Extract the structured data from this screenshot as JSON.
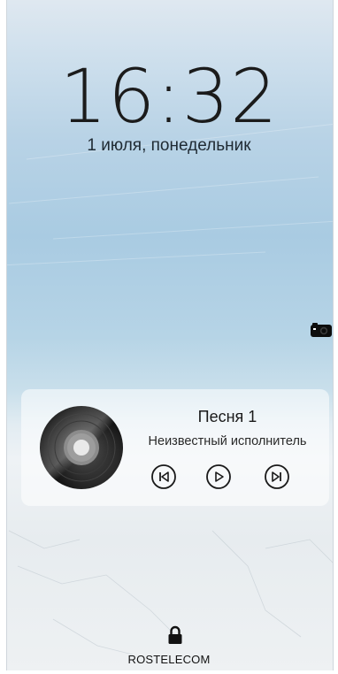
{
  "lockscreen": {
    "time": "16:32",
    "date": "1 июля, понедельник"
  },
  "music_player": {
    "title": "Песня 1",
    "artist": "Неизвестный исполнитель",
    "controls": [
      "previous",
      "play",
      "next"
    ]
  },
  "carrier": "ROSTELECOM",
  "icons": {
    "camera": "camera-icon",
    "lock": "lock-icon",
    "album": "vinyl-disc-icon"
  },
  "colors": {
    "sky_top": "#dfe8f0",
    "sky_mid": "#a9cbe2",
    "ice": "#eef1f3",
    "text": "#1b1b1b"
  }
}
